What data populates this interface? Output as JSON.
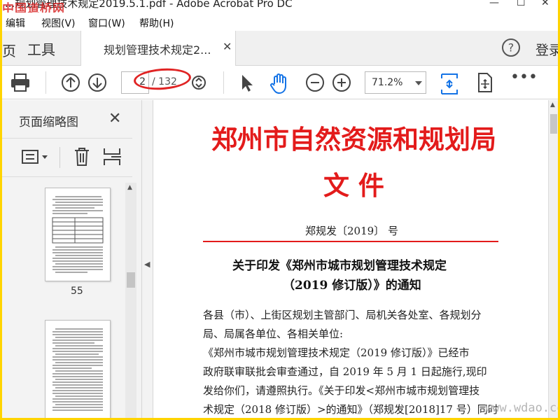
{
  "app": {
    "title": "...规划管理技术规定2019.5.1.pdf - Adobe Acrobat Pro DC",
    "watermark": "中国道桥网"
  },
  "menubar": {
    "items": [
      "编辑",
      "视图(V)",
      "窗口(W)",
      "帮助(H)"
    ]
  },
  "tabs": {
    "home_fragment": "页",
    "tools": "工具",
    "document": "规划管理技术规定2...",
    "login": "登录"
  },
  "toolbar": {
    "page_current": "2",
    "page_total": "/ 132",
    "zoom": "71.2%"
  },
  "left_panel": {
    "title": "页面缩略图",
    "thumbnails": [
      {
        "label": "55"
      }
    ]
  },
  "document": {
    "agency_line1": "郑州市自然资源和规划局",
    "agency_line2": "文  件",
    "doc_number": "郑规发〔2019〕 号",
    "title_line1": "关于印发《郑州市城市规划管理技术规定",
    "title_line2": "（2019 修订版）》的通知",
    "body": [
      "各县（市）、上街区规划主管部门、局机关各处室、各规划分",
      "局、局属各单位、各相关单位:",
      "    《郑州市城市规划管理技术规定（2019 修订版）》已经市",
      "政府联审联批会审查通过，自 2019 年 5 月 1 日起施行,现印",
      "发给你们，请遵照执行。《关于印发<郑州市城市规划管理技",
      "术规定（2018 修订版）>的通知》（郑规发[2018]17 号）同时"
    ]
  },
  "site_watermark": "www.wdao.com",
  "colors": {
    "frame": "#ffd400",
    "red_heading": "#e31b1b",
    "annotation_oval": "#e02424",
    "accent_blue": "#1473e6"
  }
}
